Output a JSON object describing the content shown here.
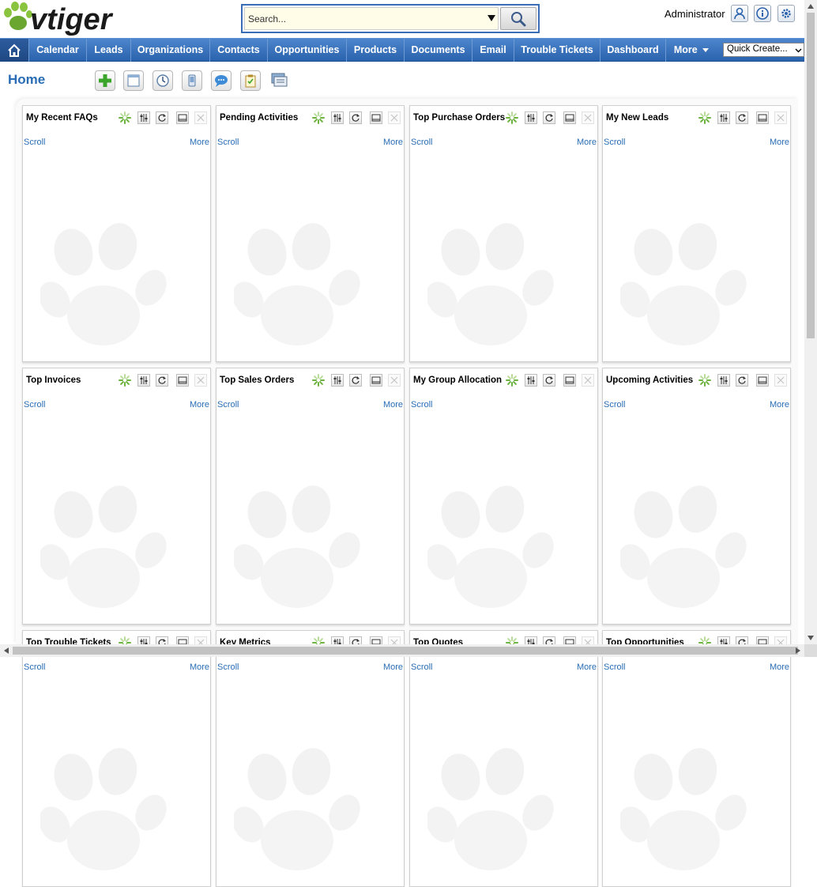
{
  "header": {
    "logo_text": "vtiger",
    "search_placeholder": "Search...",
    "user_name": "Administrator"
  },
  "nav": {
    "items": [
      "Calendar",
      "Leads",
      "Organizations",
      "Contacts",
      "Opportunities",
      "Products",
      "Documents",
      "Email",
      "Trouble Tickets",
      "Dashboard",
      "More"
    ],
    "quick_create": "Quick Create..."
  },
  "page": {
    "title": "Home"
  },
  "widget_links": {
    "scroll": "Scroll",
    "more": "More"
  },
  "widgets": [
    {
      "title": "My Recent FAQs",
      "has_more": true
    },
    {
      "title": "Pending Activities",
      "has_more": true
    },
    {
      "title": "Top Purchase Orders",
      "has_more": true
    },
    {
      "title": "My New Leads",
      "has_more": true
    },
    {
      "title": "Top Invoices",
      "has_more": true
    },
    {
      "title": "Top Sales Orders",
      "has_more": true
    },
    {
      "title": "My Group Allocation",
      "has_more": false
    },
    {
      "title": "Upcoming Activities",
      "has_more": true
    },
    {
      "title": "Top Trouble Tickets",
      "has_more": true
    },
    {
      "title": "Key Metrics",
      "has_more": true
    },
    {
      "title": "Top Quotes",
      "has_more": true
    },
    {
      "title": "Top Opportunities",
      "has_more": true
    }
  ],
  "colors": {
    "accent": "#2a6db5",
    "nav_blue": "#3a74bf",
    "search_border": "#3b6db6"
  }
}
